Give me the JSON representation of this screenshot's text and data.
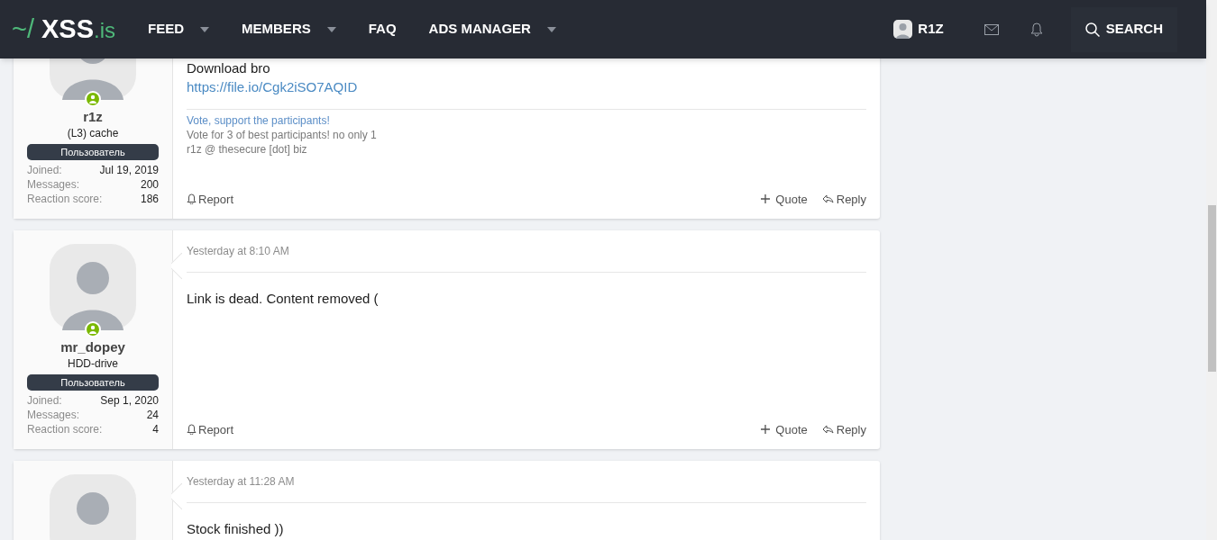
{
  "header": {
    "logo": {
      "prefix": "~/",
      "name": "XSS",
      "suffix": ".is"
    },
    "nav": [
      {
        "label": "FEED",
        "dropdown": true
      },
      {
        "label": "MEMBERS",
        "dropdown": true
      },
      {
        "label": "FAQ",
        "dropdown": false
      },
      {
        "label": "ADS MANAGER",
        "dropdown": true
      }
    ],
    "user": {
      "name": "R1Z"
    },
    "search": {
      "label": "SEARCH"
    }
  },
  "posts": [
    {
      "user": {
        "name": "r1z",
        "title": "(L3) cache",
        "role": "Пользователь",
        "online": true,
        "stats": [
          {
            "label": "Joined:",
            "value": "Jul 19, 2019"
          },
          {
            "label": "Messages:",
            "value": "200"
          },
          {
            "label": "Reaction score:",
            "value": "186"
          }
        ]
      },
      "body": [
        {
          "kind": "text",
          "text": "Download bro"
        },
        {
          "kind": "link",
          "text": "https://file.io/Cgk2iSO7AQID"
        }
      ],
      "signature": [
        "Vote, support the participants!",
        "Vote for 3 of best participants! no only 1",
        "r1z @ thesecure [dot] biz"
      ],
      "actions": {
        "report": "Report",
        "quote": "Quote",
        "reply": "Reply"
      }
    },
    {
      "user": {
        "name": "mr_dopey",
        "title": "HDD-drive",
        "role": "Пользователь",
        "online": true,
        "stats": [
          {
            "label": "Joined:",
            "value": "Sep 1, 2020"
          },
          {
            "label": "Messages:",
            "value": "24"
          },
          {
            "label": "Reaction score:",
            "value": "4"
          }
        ]
      },
      "time": "Yesterday at 8:10 AM",
      "body": [
        {
          "kind": "text",
          "text": "Link is dead. Content removed ("
        }
      ],
      "actions": {
        "report": "Report",
        "quote": "Quote",
        "reply": "Reply"
      }
    },
    {
      "time": "Yesterday at 11:28 AM",
      "body": [
        {
          "kind": "text",
          "text": "Stock finished ))"
        }
      ]
    }
  ]
}
